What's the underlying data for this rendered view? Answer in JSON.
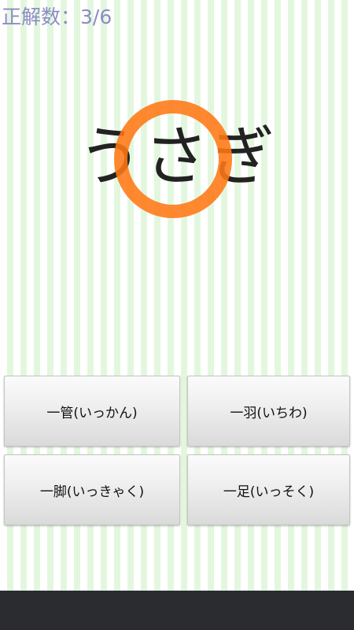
{
  "score": {
    "text": "正解数：3/6"
  },
  "question": {
    "word": "うさぎ"
  },
  "answers": [
    {
      "label": "一管(いっかん)"
    },
    {
      "label": "一羽(いちわ)"
    },
    {
      "label": "一脚(いっきゃく)"
    },
    {
      "label": "一足(いっそく)"
    }
  ],
  "feedback": {
    "icon": "correct-circle-icon",
    "color": "#ff7814"
  },
  "colors": {
    "stripe": "#e3f7df",
    "score_text": "#8c8cc4",
    "navbar": "#2a2c30"
  }
}
